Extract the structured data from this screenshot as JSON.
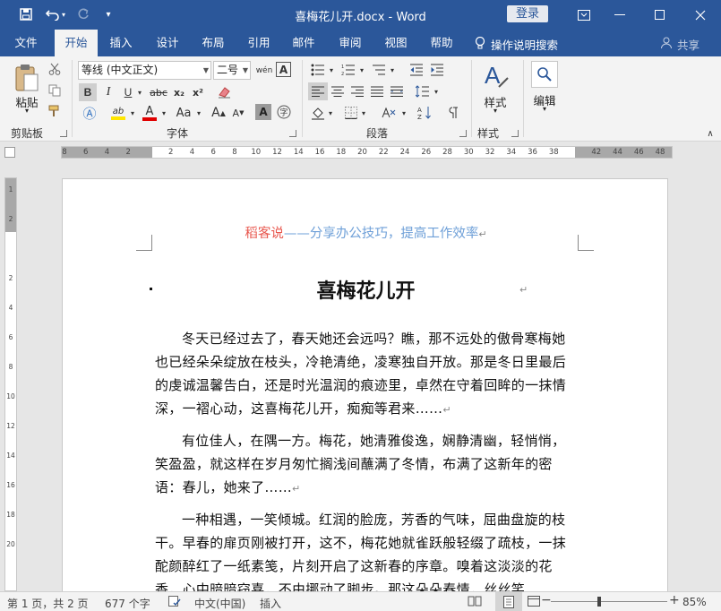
{
  "titlebar": {
    "title": "喜梅花儿开.docx  -  Word",
    "login": "登录",
    "save_icon": "save-icon",
    "undo_icon": "undo-icon",
    "redo_icon": "redo-icon"
  },
  "tabs": [
    "文件",
    "开始",
    "插入",
    "设计",
    "布局",
    "引用",
    "邮件",
    "审阅",
    "视图",
    "帮助"
  ],
  "active_tab": "开始",
  "tellme": "操作说明搜索",
  "share": "共享",
  "ribbon": {
    "clipboard": {
      "paste": "粘贴",
      "label": "剪贴板"
    },
    "font": {
      "name": "等线 (中文正文)",
      "size": "二号",
      "label": "字体",
      "bold": "B",
      "italic": "I",
      "underline": "U",
      "strike": "abc",
      "sub": "x₂",
      "sup": "x²",
      "highlight": "ab",
      "color": "A",
      "case": "Aa",
      "grow": "A",
      "shrink": "A",
      "pinyin": "wén"
    },
    "paragraph": {
      "label": "段落"
    },
    "styles": {
      "btn": "样式",
      "label": "样式"
    },
    "editing": {
      "btn": "编辑"
    }
  },
  "ruler": {
    "ticks": [
      "8",
      "6",
      "4",
      "2",
      "",
      "2",
      "4",
      "6",
      "8",
      "10",
      "12",
      "14",
      "16",
      "18",
      "20",
      "22",
      "24",
      "26",
      "28",
      "30",
      "32",
      "34",
      "36",
      "38",
      "",
      "42",
      "44",
      "46",
      "48"
    ],
    "vticks": [
      "1",
      "2",
      "",
      "2",
      "4",
      "6",
      "8",
      "10",
      "12",
      "14",
      "16",
      "18",
      "20"
    ]
  },
  "document": {
    "header_brand": "稻客说",
    "header_rest": "——分享办公技巧，提高工作效率",
    "title": "喜梅花儿开",
    "paragraphs": [
      "冬天已经过去了，春天她还会远吗？瞧，那不远处的傲骨寒梅她也已经朵朵绽放在枝头，冷艳清绝，凌寒独自开放。那是冬日里最后的虔诚温馨告白，还是时光温润的痕迹里，卓然在守着回眸的一抹情深，一褶心动，这喜梅花儿开，痴痴等君来……",
      "有位佳人，在隅一方。梅花，她清雅俊逸，娴静清幽，轻悄悄，笑盈盈，就这样在岁月匆忙搁浅间蘸满了冬情，布满了这新年的密语：春儿，她来了……",
      "一种相遇，一笑倾城。红润的脸庞，芳香的气味，屈曲盘旋的枝干。早春的扉页刚被打开，这不，梅花她就雀跃般轻缀了疏枝，一抹酡颜醉红了一纸素笺，片刻开启了这新春的序章。嗅着这淡淡的花香，心中暗暗窃喜，不由挪动了脚步。那这朵朵春情，丝丝笑"
    ]
  },
  "statusbar": {
    "page": "第 1 页，共 2 页",
    "words": "677 个字",
    "lang": "中文(中国)",
    "mode": "插入",
    "zoom": "85%",
    "zoom_level": 0.85
  },
  "colors": {
    "brand": "#2b579a",
    "header_red": "#e8584f",
    "header_blue": "#6fa0d8"
  }
}
